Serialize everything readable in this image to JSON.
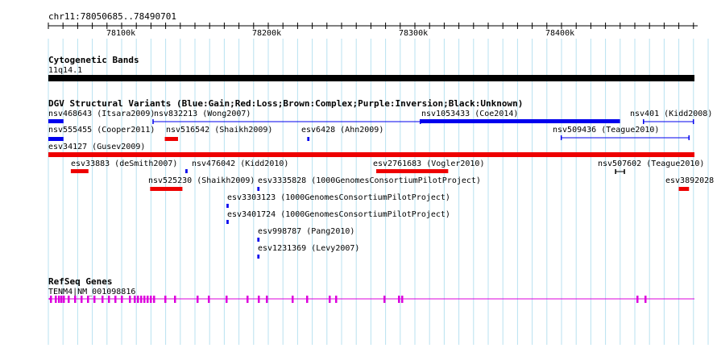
{
  "position_label": "chr11:78050685..78490701",
  "ruler": {
    "ticks": [
      "78100k",
      "78200k",
      "78300k",
      "78400k"
    ]
  },
  "cytoband": {
    "title": "Cytogenetic Bands",
    "band_label": "11q14.1"
  },
  "dgv": {
    "title": "DGV Structural Variants (Blue:Gain;Red:Loss;Brown:Complex;Purple:Inversion;Black:Unknown)",
    "colors": {
      "gain": "#0000ee",
      "loss": "#ee0000",
      "unknown": "#000000"
    },
    "features": [
      {
        "label": "nsv468643 (Itsara2009)",
        "type": "gain",
        "start": 78050685,
        "end": 78061000
      },
      {
        "label": "nsv832213 (Wong2007)",
        "type": "gain-line",
        "start": 78122000,
        "end": 78304000
      },
      {
        "label": "nsv1053433 (Coe2014)",
        "type": "gain",
        "start": 78304000,
        "end": 78440000
      },
      {
        "label": "nsv401 (Kidd2008)",
        "type": "gain-line",
        "start": 78456000,
        "end": 78490000
      },
      {
        "label": "nsv555455 (Cooper2011)",
        "type": "gain",
        "start": 78050685,
        "end": 78061000
      },
      {
        "label": "nsv516542 (Shaikh2009)",
        "type": "loss",
        "start": 78130000,
        "end": 78139000
      },
      {
        "label": "esv6428 (Ahn2009)",
        "type": "gain",
        "start": 78227000,
        "end": 78228500
      },
      {
        "label": "nsv509436 (Teague2010)",
        "type": "gain-line",
        "start": 78400000,
        "end": 78487000
      },
      {
        "label": "esv34127 (Gusev2009)",
        "type": "loss",
        "start": 78050685,
        "end": 78490701
      },
      {
        "label": "esv33883 (deSmith2007)",
        "type": "loss",
        "start": 78066000,
        "end": 78078000
      },
      {
        "label": "nsv476042 (Kidd2010)",
        "type": "gain",
        "start": 78144000,
        "end": 78145500
      },
      {
        "label": "esv2761683 (Vogler2010)",
        "type": "loss",
        "start": 78274000,
        "end": 78323000
      },
      {
        "label": "nsv507602 (Teague2010)",
        "type": "unknown",
        "start": 78437000,
        "end": 78443000
      },
      {
        "label": "nsv525230 (Shaikh2009)",
        "type": "loss",
        "start": 78120000,
        "end": 78142000
      },
      {
        "label": "esv3335828 (1000GenomesConsortiumPilotProject)",
        "type": "gain",
        "start": 78193000,
        "end": 78194500
      },
      {
        "label": "esv3892028",
        "type": "loss",
        "start": 78480000,
        "end": 78487000
      },
      {
        "label": "esv3303123 (1000GenomesConsortiumPilotProject)",
        "type": "gain",
        "start": 78172000,
        "end": 78173500
      },
      {
        "label": "esv3401724 (1000GenomesConsortiumPilotProject)",
        "type": "gain",
        "start": 78172000,
        "end": 78173500
      },
      {
        "label": "esv998787 (Pang2010)",
        "type": "gain",
        "start": 78193000,
        "end": 78194500
      },
      {
        "label": "esv1231369 (Levy2007)",
        "type": "gain",
        "start": 78193000,
        "end": 78194500
      }
    ]
  },
  "refseq": {
    "title": "RefSeq Genes",
    "gene_label": "TENM4|NM_001098816",
    "color": "#dd00dd"
  }
}
